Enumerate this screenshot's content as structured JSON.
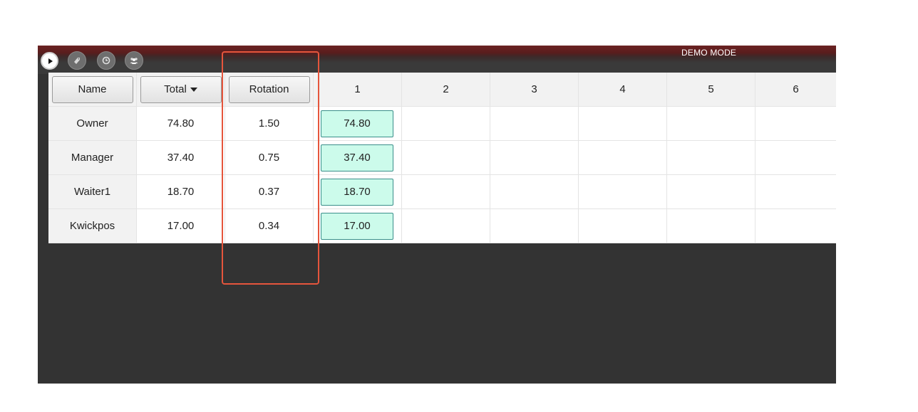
{
  "topbar": {
    "mode_label": "DEMO MODE",
    "icons": [
      "play-icon",
      "tag-icon",
      "clock-icon",
      "users-icon"
    ]
  },
  "table": {
    "headers": {
      "name": "Name",
      "total": "Total",
      "rotation": "Rotation",
      "cols": [
        "1",
        "2",
        "3",
        "4",
        "5",
        "6"
      ]
    },
    "rows": [
      {
        "name": "Owner",
        "total": "74.80",
        "rotation": "1.50",
        "c1": "74.80"
      },
      {
        "name": "Manager",
        "total": "37.40",
        "rotation": "0.75",
        "c1": "37.40"
      },
      {
        "name": "Waiter1",
        "total": "18.70",
        "rotation": "0.37",
        "c1": "18.70"
      },
      {
        "name": "Kwickpos",
        "total": "17.00",
        "rotation": "0.34",
        "c1": "17.00"
      }
    ]
  },
  "colors": {
    "accent_highlight": "#e5553c",
    "pill_bg": "#ccfbeb",
    "pill_border": "#3a8f8a",
    "topbar_red": "#6b2222"
  }
}
